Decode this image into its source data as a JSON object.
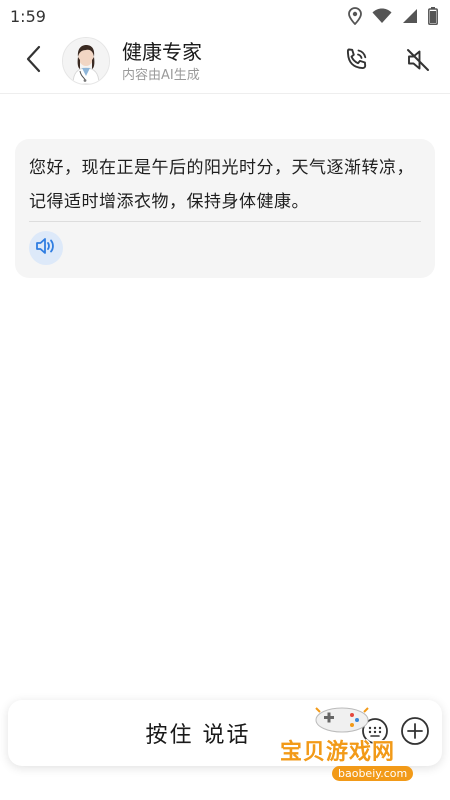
{
  "status_bar": {
    "time": "1:59"
  },
  "header": {
    "title": "健康专家",
    "subtitle": "内容由AI生成"
  },
  "chat": {
    "messages": [
      {
        "text": "您好，现在正是午后的阳光时分，天气逐渐转凉，记得适时增添衣物，保持身体健康。"
      }
    ]
  },
  "input_bar": {
    "hold_to_talk_label": "按住 说话"
  },
  "watermark": {
    "text": "宝贝游戏网",
    "url": "baobeiy.com"
  },
  "colors": {
    "accent": "#2f7de1",
    "bubble_bg": "#f5f5f5",
    "speaker_bg": "#dde9f9",
    "watermark": "#f29a18"
  },
  "icons": [
    "back-arrow-icon",
    "phone-call-icon",
    "mute-icon",
    "speaker-icon",
    "keyboard-icon",
    "plus-icon",
    "location-icon",
    "wifi-icon",
    "signal-icon",
    "battery-icon"
  ]
}
